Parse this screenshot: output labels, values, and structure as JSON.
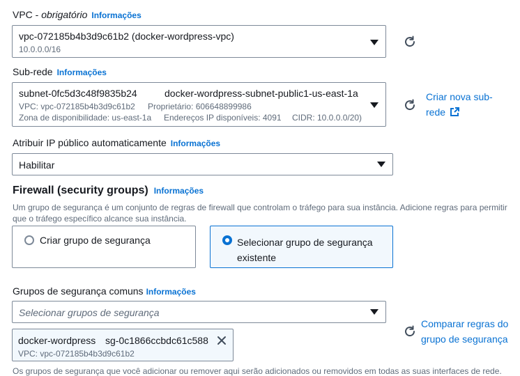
{
  "vpc": {
    "label": "VPC - ",
    "label_italic": "obrigatório",
    "info": "Informações",
    "value": "vpc-072185b4b3d9c61b2 (docker-wordpress-vpc)",
    "cidr": "10.0.0.0/16"
  },
  "subnet": {
    "label": "Sub-rede",
    "info": "Informações",
    "id": "subnet-0fc5d3c48f9835b24",
    "name": "docker-wordpress-subnet-public1-us-east-1a",
    "vpc": "VPC: vpc-072185b4b3d9c61b2",
    "owner": "Proprietário: 606648899986",
    "az": "Zona de disponibilidade: us-east-1a",
    "ips": "Endereços IP disponíveis: 4091",
    "cidr": "CIDR: 10.0.0.0/20)",
    "create_link_line1": "Criar nova sub-",
    "create_link_line2": "rede"
  },
  "public_ip": {
    "label": "Atribuir IP público automaticamente",
    "info": "Informações",
    "value": "Habilitar"
  },
  "firewall": {
    "title": "Firewall (security groups)",
    "info": "Informações",
    "desc_line1": "Um grupo de segurança é um conjunto de regras de firewall que controlam o tráfego para sua instância. Adicione regras para permitir",
    "desc_line2": "que o tráfego específico alcance sua instância.",
    "option_create": "Criar grupo de segurança",
    "option_select_line1": "Selecionar grupo de segurança",
    "option_select_line2": "existente"
  },
  "common_groups": {
    "label": "Grupos de segurança comuns",
    "info": "Informações",
    "placeholder": "Selecionar grupos de segurança",
    "token_name": "docker-wordpress",
    "token_id": "sg-0c1866ccbdc61c588",
    "token_vpc": "VPC: vpc-072185b4b3d9c61b2",
    "compare_line1": "Comparar regras do",
    "compare_line2": "grupo de segurança",
    "footer": "Os grupos de segurança que você adicionar ou remover aqui serão adicionados ou removidos em todas as suas interfaces de rede."
  },
  "colors": {
    "accent": "#0972d3",
    "border": "#7d8998",
    "selected_bg": "#f2f8fd"
  },
  "icons": [
    "refresh-icon",
    "external-link-icon",
    "close-icon",
    "caret-down-icon"
  ]
}
